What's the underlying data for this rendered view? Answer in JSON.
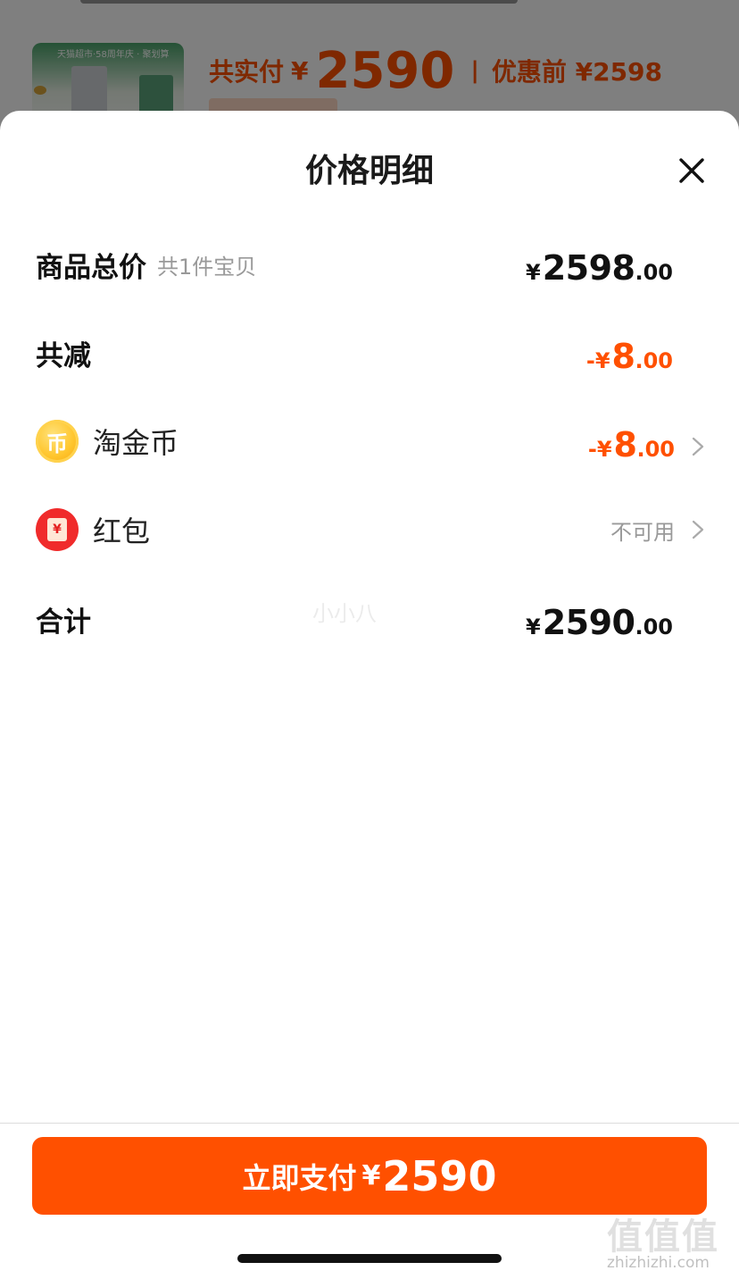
{
  "background": {
    "thumb_tag": "天猫超市·58周年庆 · 聚划算",
    "total_paid_label": "共实付",
    "yen": "¥",
    "total_paid_amount": "2590",
    "separator": "|",
    "before_discount": "优惠前 ¥2598"
  },
  "sheet": {
    "title": "价格明细",
    "close_icon": "close-icon",
    "rows": {
      "goods_total": {
        "label": "商品总价",
        "sub": "共1件宝贝",
        "yen": "¥",
        "int": "2598",
        "dec": ".00"
      },
      "total_discount": {
        "label": "共减",
        "sign_yen": "-¥",
        "int": "8",
        "dec": ".00"
      },
      "taojinbi": {
        "icon": "coin-icon",
        "icon_glyph": "币",
        "label": "淘金币",
        "sign_yen": "-¥",
        "int": "8",
        "dec": ".00"
      },
      "hongbao": {
        "icon": "red-packet-icon",
        "icon_glyph": "¥",
        "label": "红包",
        "status": "不可用"
      },
      "sum": {
        "label": "合计",
        "yen": "¥",
        "int": "2590",
        "dec": ".00"
      }
    },
    "faint_watermark": "小小八"
  },
  "footer": {
    "pay_label": "立即支付",
    "pay_yen": "¥",
    "pay_amount": "2590"
  },
  "watermark": {
    "logo": "值值值",
    "url": "zhizhizhi.com"
  },
  "colors": {
    "accent": "#ff5000",
    "text": "#111111",
    "muted": "#999999"
  }
}
